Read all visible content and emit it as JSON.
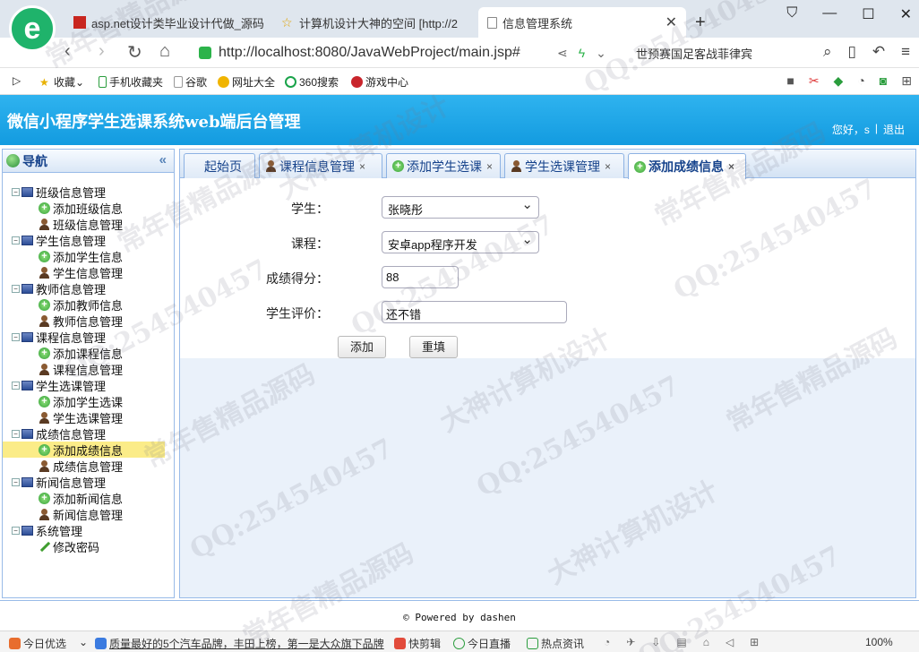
{
  "browser": {
    "tabs": [
      {
        "title": "asp.net设计类毕业设计代做_源码",
        "active": false
      },
      {
        "title": "计算机设计大神的空间 [http://2",
        "active": false
      },
      {
        "title": "信息管理系统",
        "active": true
      }
    ],
    "new_tab": "+",
    "url": "http://localhost:8080/JavaWebProject/main.jsp#",
    "search_hint": "世预赛国足客战菲律宾",
    "bookmarks": [
      "收藏",
      "手机收藏夹",
      "谷歌",
      "网址大全",
      "360搜索",
      "游戏中心"
    ]
  },
  "app": {
    "title": "微信小程序学生选课系统web端后台管理",
    "greeting": "您好，s",
    "separator": "|",
    "logout": "退出"
  },
  "nav": {
    "title": "导航",
    "collapse": "«",
    "groups": [
      {
        "label": "班级信息管理",
        "items": [
          {
            "label": "添加班级信息",
            "icon": "add-icon"
          },
          {
            "label": "班级信息管理",
            "icon": "person-icon"
          }
        ]
      },
      {
        "label": "学生信息管理",
        "items": [
          {
            "label": "添加学生信息",
            "icon": "add-icon"
          },
          {
            "label": "学生信息管理",
            "icon": "person-icon"
          }
        ]
      },
      {
        "label": "教师信息管理",
        "items": [
          {
            "label": "添加教师信息",
            "icon": "add-icon"
          },
          {
            "label": "教师信息管理",
            "icon": "person-icon"
          }
        ]
      },
      {
        "label": "课程信息管理",
        "items": [
          {
            "label": "添加课程信息",
            "icon": "add-icon"
          },
          {
            "label": "课程信息管理",
            "icon": "person-icon"
          }
        ]
      },
      {
        "label": "学生选课管理",
        "items": [
          {
            "label": "添加学生选课",
            "icon": "add-icon"
          },
          {
            "label": "学生选课管理",
            "icon": "person-icon"
          }
        ]
      },
      {
        "label": "成绩信息管理",
        "items": [
          {
            "label": "添加成绩信息",
            "icon": "add-icon",
            "selected": true
          },
          {
            "label": "成绩信息管理",
            "icon": "person-icon"
          }
        ]
      },
      {
        "label": "新闻信息管理",
        "items": [
          {
            "label": "添加新闻信息",
            "icon": "add-icon"
          },
          {
            "label": "新闻信息管理",
            "icon": "person-icon"
          }
        ]
      },
      {
        "label": "系统管理",
        "items": [
          {
            "label": "修改密码",
            "icon": "pencil-icon"
          }
        ]
      }
    ]
  },
  "tabs": [
    {
      "label": "起始页",
      "closable": false,
      "icon": ""
    },
    {
      "label": "课程信息管理",
      "closable": true,
      "icon": "person-icon"
    },
    {
      "label": "添加学生选课",
      "closable": true,
      "icon": "add-icon"
    },
    {
      "label": "学生选课管理",
      "closable": true,
      "icon": "person-icon"
    },
    {
      "label": "添加成绩信息",
      "closable": true,
      "icon": "add-icon",
      "active": true
    }
  ],
  "tab_close": "×",
  "form": {
    "student_label": "学生：",
    "student_value": "张晓彤",
    "course_label": "课程：",
    "course_value": "安卓app程序开发",
    "score_label": "成绩得分：",
    "score_value": "88",
    "comment_label": "学生评价：",
    "comment_value": "还不错",
    "add_button": "添加",
    "reset_button": "重填"
  },
  "footer": "© Powered by dashen",
  "statusbar": {
    "items": [
      "今日优选",
      "质量最好的5个汽车品牌，丰田上榜，第一是大众旗下品牌",
      "快剪辑",
      "今日直播",
      "热点资讯"
    ],
    "zoom": "100%"
  },
  "watermarks": [
    "QQ:254540457",
    "大神计算机设计",
    "常年售精品源码"
  ]
}
